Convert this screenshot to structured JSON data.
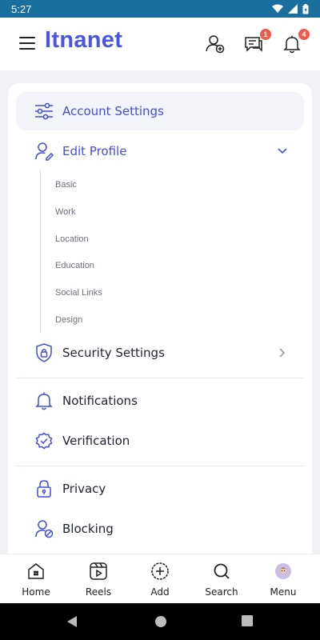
{
  "status": {
    "time": "5:27"
  },
  "app": {
    "title": "Itnanet"
  },
  "header_badges": {
    "messages": "1",
    "notifications": "4"
  },
  "menu": {
    "account_settings": "Account Settings",
    "edit_profile": "Edit Profile",
    "edit_profile_sub": [
      "Basic",
      "Work",
      "Location",
      "Education",
      "Social Links",
      "Design"
    ],
    "security_settings": "Security Settings",
    "notifications": "Notifications",
    "verification": "Verification",
    "privacy": "Privacy",
    "blocking": "Blocking"
  },
  "bottom_nav": {
    "home": "Home",
    "reels": "Reels",
    "add": "Add",
    "search": "Search",
    "menu": "Menu"
  },
  "colors": {
    "brand": "#4a56e2",
    "status_bar": "#1a6f9f",
    "badge": "#f05a4a",
    "icon_blue": "#3f4fd8"
  }
}
